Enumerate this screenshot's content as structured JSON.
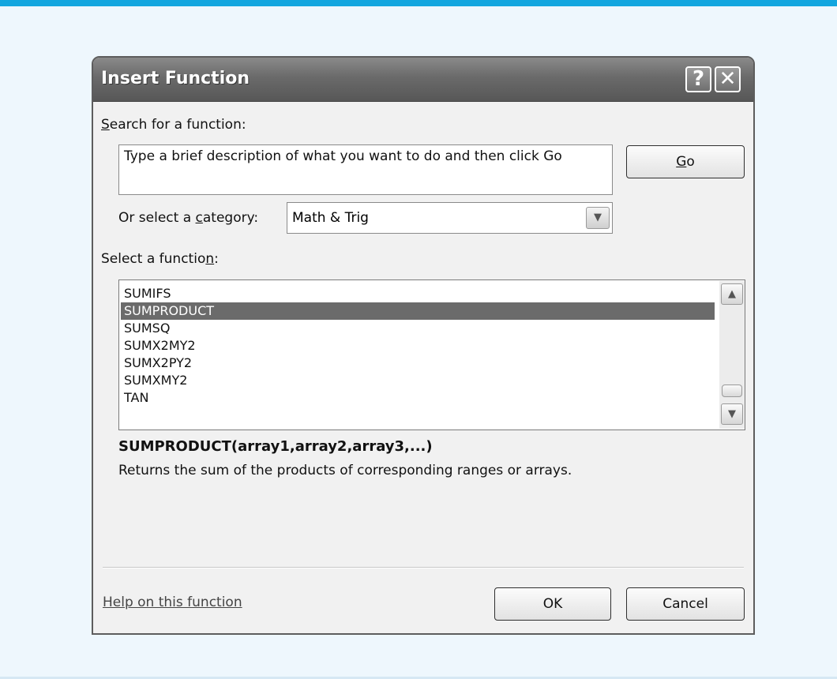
{
  "dialog": {
    "title": "Insert Function",
    "help_icon": "question-mark-icon",
    "close_icon": "close-x-icon"
  },
  "search": {
    "label_prefix": "",
    "label_underlined": "S",
    "label_rest": "earch for a function:",
    "value": "Type a brief description of what you want to do and then click Go",
    "go_underlined": "G",
    "go_rest": "o"
  },
  "category": {
    "label_prefix": "Or select a ",
    "label_underlined": "c",
    "label_rest": "ategory:",
    "selected": "Math & Trig",
    "arrow_icon": "chevron-down-icon"
  },
  "functions": {
    "label_prefix": "Select a functio",
    "label_underlined": "n",
    "label_rest": ":",
    "items": [
      "SUMIFS",
      "SUMPRODUCT",
      "SUMSQ",
      "SUMX2MY2",
      "SUMX2PY2",
      "SUMXMY2",
      "TAN"
    ],
    "selected": "SUMPRODUCT"
  },
  "details": {
    "signature": "SUMPRODUCT(array1,array2,array3,...)",
    "description": "Returns the sum of the products of corresponding ranges or arrays."
  },
  "footer": {
    "help_link": "Help on this function",
    "ok_label": "OK",
    "cancel_label": "Cancel"
  },
  "colors": {
    "accent": "#12a6df",
    "selection": "#6b6b6b",
    "background": "#eef7fd"
  }
}
